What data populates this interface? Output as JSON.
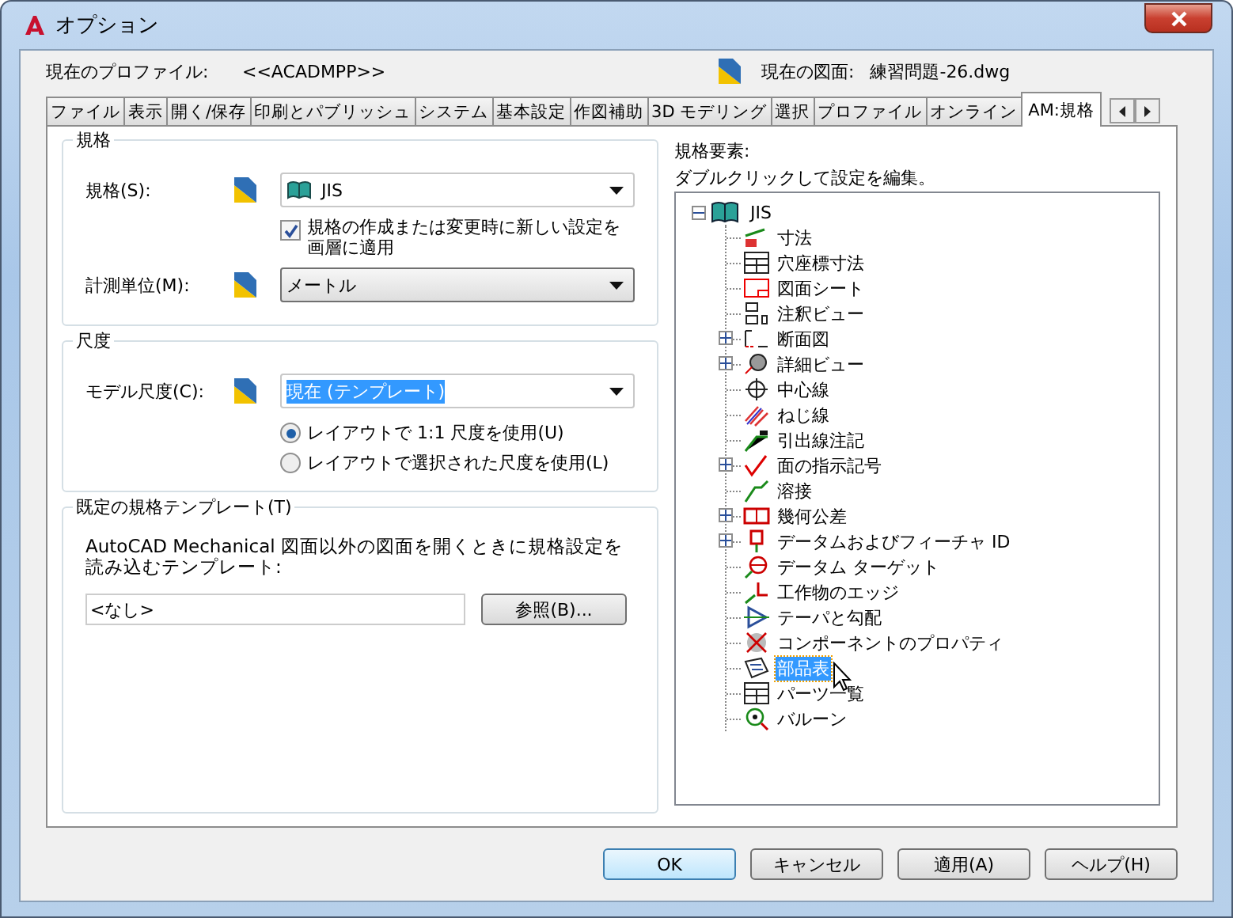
{
  "window": {
    "title": "オプション"
  },
  "profile": {
    "label": "現在のプロファイル:",
    "value": "<<ACADMPP>>"
  },
  "drawing": {
    "label": "現在の図面:",
    "value": "練習問題-26.dwg"
  },
  "tabs": [
    {
      "label": "ファイル",
      "selected": false
    },
    {
      "label": "表示",
      "selected": false
    },
    {
      "label": "開く/保存",
      "selected": false
    },
    {
      "label": "印刷とパブリッシュ",
      "selected": false
    },
    {
      "label": "システム",
      "selected": false
    },
    {
      "label": "基本設定",
      "selected": false
    },
    {
      "label": "作図補助",
      "selected": false
    },
    {
      "label": "3D モデリング",
      "selected": false
    },
    {
      "label": "選択",
      "selected": false
    },
    {
      "label": "プロファイル",
      "selected": false
    },
    {
      "label": "オンライン",
      "selected": false
    },
    {
      "label": "AM:規格",
      "selected": true
    }
  ],
  "standards_group": {
    "title": "規格",
    "standard": {
      "label": "規格(S):",
      "value": "JIS"
    },
    "apply_checkbox": {
      "label": "規格の作成または変更時に新しい設定を画層に適用",
      "checked": true
    },
    "units": {
      "label": "計測単位(M):",
      "value": "メートル"
    }
  },
  "scale_group": {
    "title": "尺度",
    "model_scale": {
      "label": "モデル尺度(C):",
      "value": "現在 (テンプレート)"
    },
    "options": [
      {
        "label": "レイアウトで 1:1 尺度を使用(U)",
        "selected": true
      },
      {
        "label": "レイアウトで選択された尺度を使用(L)",
        "selected": false
      }
    ]
  },
  "template_group": {
    "title": "既定の規格テンプレート(T)",
    "description": "AutoCAD Mechanical 図面以外の図面を開くときに規格設定を読み込むテンプレート:",
    "value": "<なし>",
    "browse_button": "参照(B)..."
  },
  "elements": {
    "label": "規格要素:",
    "hint": "ダブルクリックして設定を編集。",
    "tree": {
      "label": "JIS",
      "expanded": true,
      "children": [
        {
          "label": "寸法",
          "collapsed": false,
          "selected": false
        },
        {
          "label": "穴座標寸法",
          "collapsed": false,
          "selected": false
        },
        {
          "label": "図面シート",
          "collapsed": false,
          "selected": false
        },
        {
          "label": "注釈ビュー",
          "collapsed": false,
          "selected": false
        },
        {
          "label": "断面図",
          "collapsed": true,
          "selected": false
        },
        {
          "label": "詳細ビュー",
          "collapsed": true,
          "selected": false
        },
        {
          "label": "中心線",
          "collapsed": false,
          "selected": false
        },
        {
          "label": "ねじ線",
          "collapsed": false,
          "selected": false
        },
        {
          "label": "引出線注記",
          "collapsed": false,
          "selected": false
        },
        {
          "label": "面の指示記号",
          "collapsed": true,
          "selected": false
        },
        {
          "label": "溶接",
          "collapsed": false,
          "selected": false
        },
        {
          "label": "幾何公差",
          "collapsed": true,
          "selected": false
        },
        {
          "label": "データムおよびフィーチャ ID",
          "collapsed": true,
          "selected": false
        },
        {
          "label": "データム ターゲット",
          "collapsed": false,
          "selected": false
        },
        {
          "label": "工作物のエッジ",
          "collapsed": false,
          "selected": false
        },
        {
          "label": "テーパと勾配",
          "collapsed": false,
          "selected": false
        },
        {
          "label": "コンポーネントのプロパティ",
          "collapsed": false,
          "selected": false
        },
        {
          "label": "部品表",
          "collapsed": false,
          "selected": true
        },
        {
          "label": "パーツ一覧",
          "collapsed": false,
          "selected": false
        },
        {
          "label": "バルーン",
          "collapsed": false,
          "selected": false
        }
      ]
    }
  },
  "buttons": [
    {
      "label": "OK",
      "default": true
    },
    {
      "label": "キャンセル",
      "default": false
    },
    {
      "label": "適用(A)",
      "default": false
    },
    {
      "label": "ヘルプ(H)",
      "default": false
    }
  ]
}
